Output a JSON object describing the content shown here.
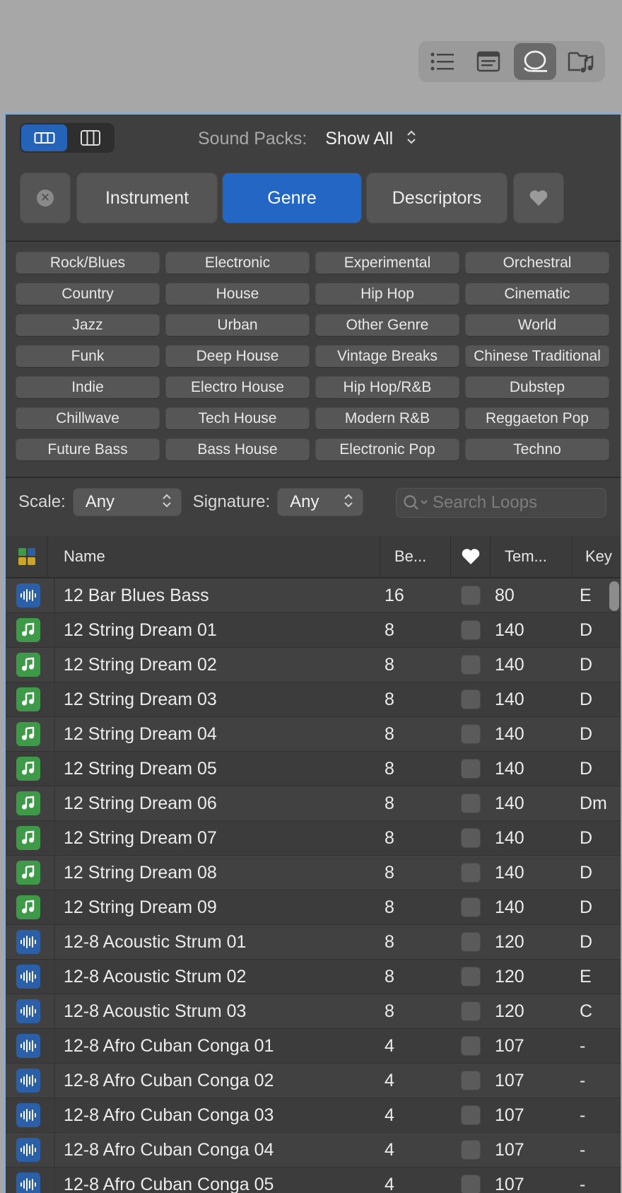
{
  "toolbar": {
    "icons": [
      "list-view-icon",
      "notes-icon",
      "loop-browser-icon",
      "media-browser-icon"
    ],
    "active": "loop-browser-icon"
  },
  "header": {
    "sound_packs_label": "Sound Packs:",
    "sound_packs_value": "Show All"
  },
  "categories": {
    "instrument": "Instrument",
    "genre": "Genre",
    "descriptors": "Descriptors",
    "active": "Genre"
  },
  "genres": [
    "Rock/Blues",
    "Electronic",
    "Experimental",
    "Orchestral",
    "Country",
    "House",
    "Hip Hop",
    "Cinematic",
    "Jazz",
    "Urban",
    "Other Genre",
    "World",
    "Funk",
    "Deep House",
    "Vintage Breaks",
    "Chinese Traditional",
    "Indie",
    "Electro House",
    "Hip Hop/R&B",
    "Dubstep",
    "Chillwave",
    "Tech House",
    "Modern R&B",
    "Reggaeton Pop",
    "Future Bass",
    "Bass House",
    "Electronic Pop",
    "Techno"
  ],
  "filters": {
    "scale_label": "Scale:",
    "scale_value": "Any",
    "signature_label": "Signature:",
    "signature_value": "Any",
    "search_placeholder": "Search Loops"
  },
  "table": {
    "columns": {
      "name": "Name",
      "beats": "Be...",
      "tempo": "Tem...",
      "key": "Key"
    },
    "rows": [
      {
        "type": "audio",
        "name": "12 Bar Blues Bass",
        "beats": "16",
        "tempo": "80",
        "key": "E"
      },
      {
        "type": "midi",
        "name": "12 String Dream 01",
        "beats": "8",
        "tempo": "140",
        "key": "D"
      },
      {
        "type": "midi",
        "name": "12 String Dream 02",
        "beats": "8",
        "tempo": "140",
        "key": "D"
      },
      {
        "type": "midi",
        "name": "12 String Dream 03",
        "beats": "8",
        "tempo": "140",
        "key": "D"
      },
      {
        "type": "midi",
        "name": "12 String Dream 04",
        "beats": "8",
        "tempo": "140",
        "key": "D"
      },
      {
        "type": "midi",
        "name": "12 String Dream 05",
        "beats": "8",
        "tempo": "140",
        "key": "D"
      },
      {
        "type": "midi",
        "name": "12 String Dream 06",
        "beats": "8",
        "tempo": "140",
        "key": "Dm"
      },
      {
        "type": "midi",
        "name": "12 String Dream 07",
        "beats": "8",
        "tempo": "140",
        "key": "D"
      },
      {
        "type": "midi",
        "name": "12 String Dream 08",
        "beats": "8",
        "tempo": "140",
        "key": "D"
      },
      {
        "type": "midi",
        "name": "12 String Dream 09",
        "beats": "8",
        "tempo": "140",
        "key": "D"
      },
      {
        "type": "audio",
        "name": "12-8 Acoustic Strum 01",
        "beats": "8",
        "tempo": "120",
        "key": "D"
      },
      {
        "type": "audio",
        "name": "12-8 Acoustic Strum 02",
        "beats": "8",
        "tempo": "120",
        "key": "E"
      },
      {
        "type": "audio",
        "name": "12-8 Acoustic Strum 03",
        "beats": "8",
        "tempo": "120",
        "key": "C"
      },
      {
        "type": "audio",
        "name": "12-8 Afro Cuban Conga 01",
        "beats": "4",
        "tempo": "107",
        "key": "-"
      },
      {
        "type": "audio",
        "name": "12-8 Afro Cuban Conga 02",
        "beats": "4",
        "tempo": "107",
        "key": "-"
      },
      {
        "type": "audio",
        "name": "12-8 Afro Cuban Conga 03",
        "beats": "4",
        "tempo": "107",
        "key": "-"
      },
      {
        "type": "audio",
        "name": "12-8 Afro Cuban Conga 04",
        "beats": "4",
        "tempo": "107",
        "key": "-"
      },
      {
        "type": "audio",
        "name": "12-8 Afro Cuban Conga 05",
        "beats": "4",
        "tempo": "107",
        "key": "-"
      }
    ]
  },
  "colors": {
    "accent": "#2466c4",
    "audio_icon": "#2b5fa8",
    "midi_icon": "#3e9a48"
  }
}
